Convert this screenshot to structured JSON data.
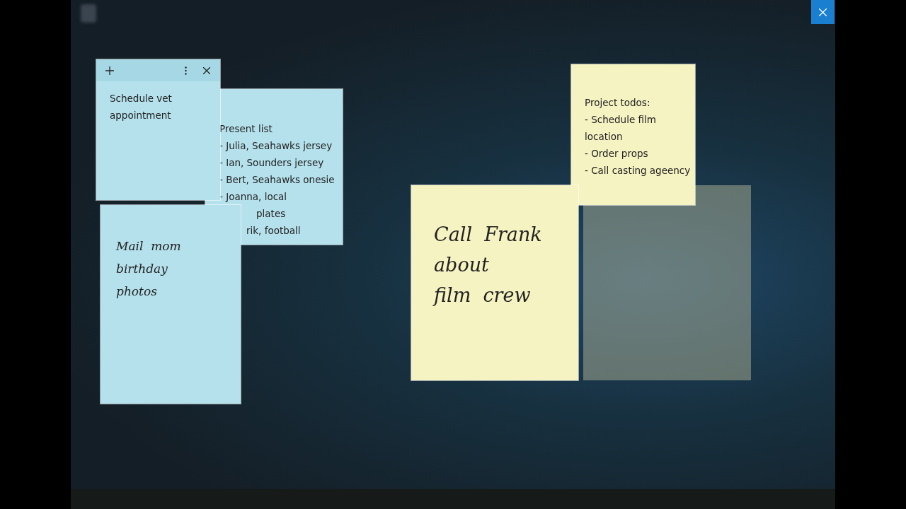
{
  "notes": [
    {
      "kind": "typed",
      "color": "#b5e1ec",
      "lines": [
        "Present list",
        "- Julia, Seahawks jersey",
        "- Ian, Sounders jersey",
        "- Bert, Seahawks onesie",
        "- Joanna, local",
        "plates",
        "rik, football"
      ]
    },
    {
      "kind": "typed",
      "color": "#b5e1ec",
      "header": true,
      "lines": [
        "Schedule vet",
        "appointment"
      ]
    },
    {
      "kind": "ink",
      "color": "#b5e1ec",
      "lines": [
        "Mail  mom",
        "birthday",
        "photos"
      ]
    },
    {
      "kind": "typed",
      "color": "#f5f3c1",
      "lines": [
        "Project todos:",
        "- Schedule film",
        "location",
        "- Order props",
        "- Call casting ageency"
      ]
    },
    {
      "kind": "ink-large",
      "color": "#f5f3c1",
      "lines": [
        "Call  Frank",
        "about",
        "film  crew"
      ]
    }
  ]
}
